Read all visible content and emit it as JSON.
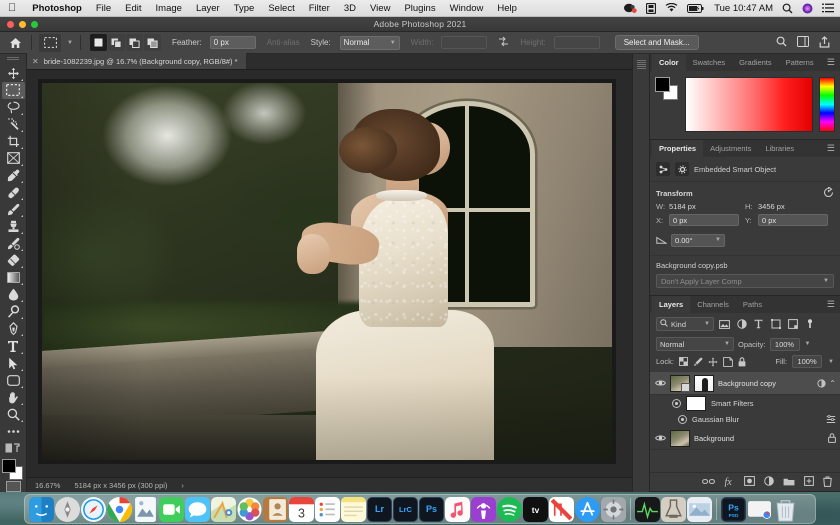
{
  "menubar": {
    "apple_icon": "apple-icon",
    "app_name": "Photoshop",
    "menus": [
      "File",
      "Edit",
      "Image",
      "Layer",
      "Type",
      "Select",
      "Filter",
      "3D",
      "View",
      "Plugins",
      "Window",
      "Help"
    ],
    "status_icons": [
      "dropbox-icon",
      "display-icon",
      "wifi-icon",
      "battery-icon"
    ],
    "clock": "Tue 10:47 AM",
    "right_icons": [
      "search-icon",
      "siri-icon",
      "control-center-icon"
    ]
  },
  "window": {
    "title": "Adobe Photoshop 2021"
  },
  "options_bar": {
    "home_icon": "home-icon",
    "tool_icon": "rectangular-marquee-icon",
    "selection_modes": [
      "new-selection-icon",
      "add-to-selection-icon",
      "subtract-from-selection-icon",
      "intersect-selection-icon"
    ],
    "feather_label": "Feather:",
    "feather_value": "0 px",
    "antialias_label": "Anti-alias",
    "style_label": "Style:",
    "style_value": "Normal",
    "width_label": "Width:",
    "width_value": "",
    "height_label": "Height:",
    "height_value": "",
    "swap_icon": "swap-dimensions-icon",
    "select_and_mask": "Select and Mask...",
    "right_icons": [
      "search-icon",
      "workspace-icon",
      "share-icon"
    ]
  },
  "toolbar": {
    "tools": [
      {
        "name": "move-tool",
        "active": false
      },
      {
        "name": "rectangular-marquee-tool",
        "active": true
      },
      {
        "name": "lasso-tool",
        "active": false
      },
      {
        "name": "quick-selection-tool",
        "active": false
      },
      {
        "name": "crop-tool",
        "active": false
      },
      {
        "name": "frame-tool",
        "active": false
      },
      {
        "name": "eyedropper-tool",
        "active": false
      },
      {
        "name": "spot-healing-brush-tool",
        "active": false
      },
      {
        "name": "brush-tool",
        "active": false
      },
      {
        "name": "clone-stamp-tool",
        "active": false
      },
      {
        "name": "history-brush-tool",
        "active": false
      },
      {
        "name": "eraser-tool",
        "active": false
      },
      {
        "name": "gradient-tool",
        "active": false
      },
      {
        "name": "blur-tool",
        "active": false
      },
      {
        "name": "dodge-tool",
        "active": false
      },
      {
        "name": "pen-tool",
        "active": false
      },
      {
        "name": "type-tool",
        "active": false
      },
      {
        "name": "path-selection-tool",
        "active": false
      },
      {
        "name": "rectangle-tool",
        "active": false
      },
      {
        "name": "hand-tool",
        "active": false
      },
      {
        "name": "zoom-tool",
        "active": false
      },
      {
        "name": "edit-toolbar-tool",
        "active": false
      }
    ],
    "foreground_color": "#000000",
    "background_color": "#ffffff"
  },
  "document": {
    "tab_label": "bride-1082239.jpg @ 16.7% (Background copy, RGB/8#) *",
    "close_icon": "close-icon"
  },
  "statusbar": {
    "zoom": "16.67%",
    "dimensions": "5184 px x 3456 px (300 ppi)",
    "arrow": "›"
  },
  "color_panel": {
    "tabs": [
      {
        "label": "Color",
        "active": true
      },
      {
        "label": "Swatches",
        "active": false
      },
      {
        "label": "Gradients",
        "active": false
      },
      {
        "label": "Patterns",
        "active": false
      }
    ],
    "menu_icon": "panel-menu-icon",
    "foreground": "#000000",
    "background": "#ffffff"
  },
  "properties_panel": {
    "tabs": [
      {
        "label": "Properties",
        "active": true
      },
      {
        "label": "Adjustments",
        "active": false
      },
      {
        "label": "Libraries",
        "active": false
      }
    ],
    "menu_icon": "panel-menu-icon",
    "object_type": "Embedded Smart Object",
    "transform": {
      "title": "Transform",
      "reset_icon": "reset-icon",
      "w_label": "W:",
      "w_value": "5184 px",
      "h_label": "H:",
      "h_value": "3456 px",
      "x_label": "X:",
      "x_value": "0 px",
      "y_label": "Y:",
      "y_value": "0 px",
      "angle_icon": "angle-icon",
      "angle_value": "0.00°"
    },
    "layer_comp": {
      "file_name": "Background copy.psb",
      "selected": "Don't Apply Layer Comp"
    }
  },
  "layers_panel": {
    "tabs": [
      {
        "label": "Layers",
        "active": true
      },
      {
        "label": "Channels",
        "active": false
      },
      {
        "label": "Paths",
        "active": false
      }
    ],
    "menu_icon": "panel-menu-icon",
    "filter": {
      "search_icon": "search-icon",
      "kind_label": "Kind",
      "chevron": "⌄",
      "filter_icons": [
        "pixel-layer-filter-icon",
        "adjustment-layer-filter-icon",
        "type-layer-filter-icon",
        "shape-layer-filter-icon",
        "smart-object-filter-icon"
      ],
      "toggle_icon": "filter-toggle-icon"
    },
    "blend_mode": "Normal",
    "opacity_label": "Opacity:",
    "opacity_value": "100%",
    "lock_label": "Lock:",
    "lock_icons": [
      "lock-transparent-pixels-icon",
      "lock-image-pixels-icon",
      "lock-position-icon",
      "lock-artboard-icon",
      "lock-all-icon"
    ],
    "fill_label": "Fill:",
    "fill_value": "100%",
    "layers": [
      {
        "name": "Background copy",
        "visible": true,
        "selected": true,
        "kind": "smart-object",
        "has_mask": true,
        "right_icon": "smart-filters-icon",
        "chevron": "⌃"
      },
      {
        "name": "Smart Filters",
        "visible": true,
        "selected": false,
        "kind": "smart-filters",
        "indent": 1
      },
      {
        "name": "Gaussian Blur",
        "visible": true,
        "selected": false,
        "kind": "filter",
        "indent": 2,
        "right_icon": "filter-options-icon"
      },
      {
        "name": "Background",
        "visible": true,
        "selected": false,
        "kind": "pixel",
        "right_icon": "lock-icon"
      }
    ],
    "footer_icons": [
      "link-layers-icon",
      "add-layer-style-icon",
      "add-layer-mask-icon",
      "new-adjustment-layer-icon",
      "new-group-icon",
      "new-layer-icon",
      "delete-layer-icon"
    ]
  },
  "dock": {
    "items": [
      {
        "name": "finder",
        "label": "",
        "bg": "#2a9fe0",
        "running": true
      },
      {
        "name": "launchpad",
        "label": "",
        "bg": "#d7d7d7",
        "running": false
      },
      {
        "name": "safari",
        "label": "",
        "bg": "#1b9bf0",
        "running": false
      },
      {
        "name": "chrome",
        "label": "",
        "bg": "#ffffff",
        "running": true
      },
      {
        "name": "preview",
        "label": "",
        "bg": "#e9eef5",
        "running": false
      },
      {
        "name": "facetime",
        "label": "",
        "bg": "#4cd964",
        "running": false
      },
      {
        "name": "messages",
        "label": "",
        "bg": "#3ec6ff",
        "running": false
      },
      {
        "name": "maps",
        "label": "",
        "bg": "#eef2e4",
        "running": false
      },
      {
        "name": "photos",
        "label": "",
        "bg": "#ffffff",
        "running": false
      },
      {
        "name": "contacts",
        "label": "",
        "bg": "#c08850",
        "running": false
      },
      {
        "name": "calendar",
        "label": "3",
        "bg": "#ffffff",
        "running": false
      },
      {
        "name": "reminders",
        "label": "",
        "bg": "#ffffff",
        "running": false
      },
      {
        "name": "notes",
        "label": "",
        "bg": "#fff6cc",
        "running": false
      },
      {
        "name": "lightroom",
        "label": "Lr",
        "bg": "#0f1620",
        "running": false
      },
      {
        "name": "lightroom-classic",
        "label": "LrC",
        "bg": "#0f1620",
        "running": true
      },
      {
        "name": "photoshop",
        "label": "Ps",
        "bg": "#0f1620",
        "running": true
      },
      {
        "name": "music",
        "label": "",
        "bg": "#ffffff",
        "running": false
      },
      {
        "name": "podcasts",
        "label": "",
        "bg": "#9b3fd4",
        "running": false
      },
      {
        "name": "spotify",
        "label": "",
        "bg": "#1db954",
        "running": false
      },
      {
        "name": "apple-tv",
        "label": "tv",
        "bg": "#101010",
        "running": false
      },
      {
        "name": "news",
        "label": "",
        "bg": "#ffffff",
        "running": false
      },
      {
        "name": "app-store",
        "label": "",
        "bg": "#2e9bf5",
        "running": false
      },
      {
        "name": "system-preferences",
        "label": "",
        "bg": "#9aa0a6",
        "running": false
      }
    ],
    "recent": [
      {
        "name": "activity-monitor",
        "bg": "#111111",
        "running": true
      },
      {
        "name": "utility-app",
        "bg": "#c9c3b5",
        "running": false
      },
      {
        "name": "image-capture",
        "bg": "#dfe6ee",
        "running": false
      }
    ],
    "minimized": [
      {
        "name": "photoshop-document",
        "label": "Ps",
        "bg": "#0f1620"
      },
      {
        "name": "chrome-window",
        "label": "",
        "bg": "#f2f2f2"
      }
    ],
    "trash": {
      "name": "trash",
      "bg": "#e8eef2"
    }
  }
}
